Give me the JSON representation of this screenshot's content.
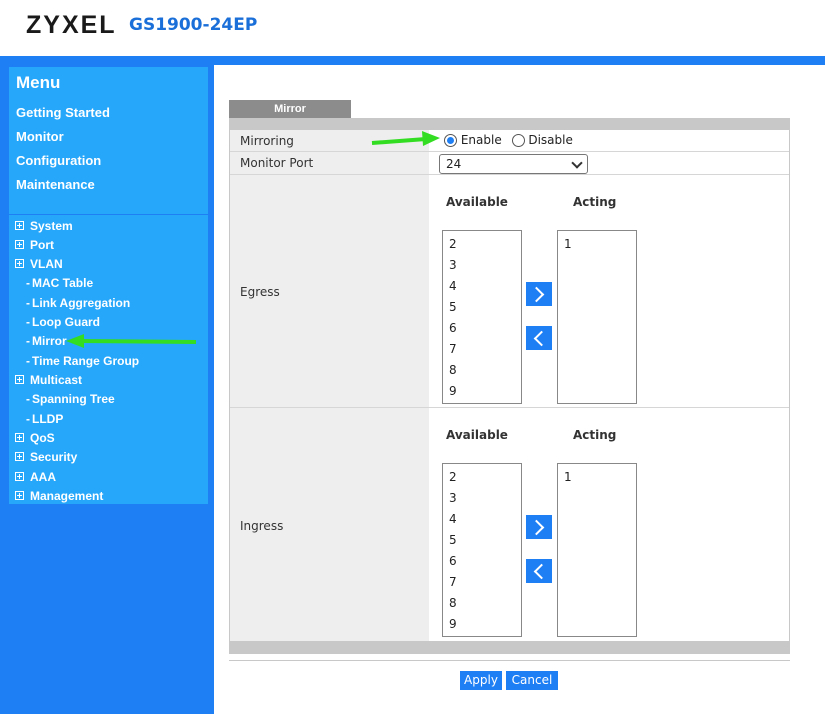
{
  "header": {
    "brand": "ZYXEL",
    "model": "GS1900-24EP"
  },
  "menu": {
    "title": "Menu",
    "links": [
      "Getting Started",
      "Monitor",
      "Configuration",
      "Maintenance"
    ]
  },
  "tree": [
    {
      "label": "System",
      "expandable": true
    },
    {
      "label": "Port",
      "expandable": true
    },
    {
      "label": "VLAN",
      "expandable": true
    },
    {
      "label": "MAC Table",
      "expandable": false
    },
    {
      "label": "Link Aggregation",
      "expandable": false
    },
    {
      "label": "Loop Guard",
      "expandable": false
    },
    {
      "label": "Mirror",
      "expandable": false
    },
    {
      "label": "Time Range Group",
      "expandable": false
    },
    {
      "label": "Multicast",
      "expandable": true
    },
    {
      "label": "Spanning Tree",
      "expandable": false
    },
    {
      "label": "LLDP",
      "expandable": false
    },
    {
      "label": "QoS",
      "expandable": true
    },
    {
      "label": "Security",
      "expandable": true
    },
    {
      "label": "AAA",
      "expandable": true
    },
    {
      "label": "Management",
      "expandable": true
    }
  ],
  "tab": "Mirror",
  "mirroring": {
    "label": "Mirroring",
    "enable": "Enable",
    "disable": "Disable",
    "selected": "enable"
  },
  "monitor_port": {
    "label": "Monitor Port",
    "value": "24"
  },
  "egress": {
    "label": "Egress",
    "available_title": "Available",
    "acting_title": "Acting",
    "available": [
      "2",
      "3",
      "4",
      "5",
      "6",
      "7",
      "8",
      "9"
    ],
    "acting": [
      "1"
    ]
  },
  "ingress": {
    "label": "Ingress",
    "available_title": "Available",
    "acting_title": "Acting",
    "available": [
      "2",
      "3",
      "4",
      "5",
      "6",
      "7",
      "8",
      "9"
    ],
    "acting": [
      "1"
    ]
  },
  "buttons": {
    "apply": "Apply",
    "cancel": "Cancel"
  },
  "colors": {
    "accent": "#1e7ff5",
    "menu_bg": "#27a7fa",
    "annotation_arrow": "#33dd22"
  }
}
